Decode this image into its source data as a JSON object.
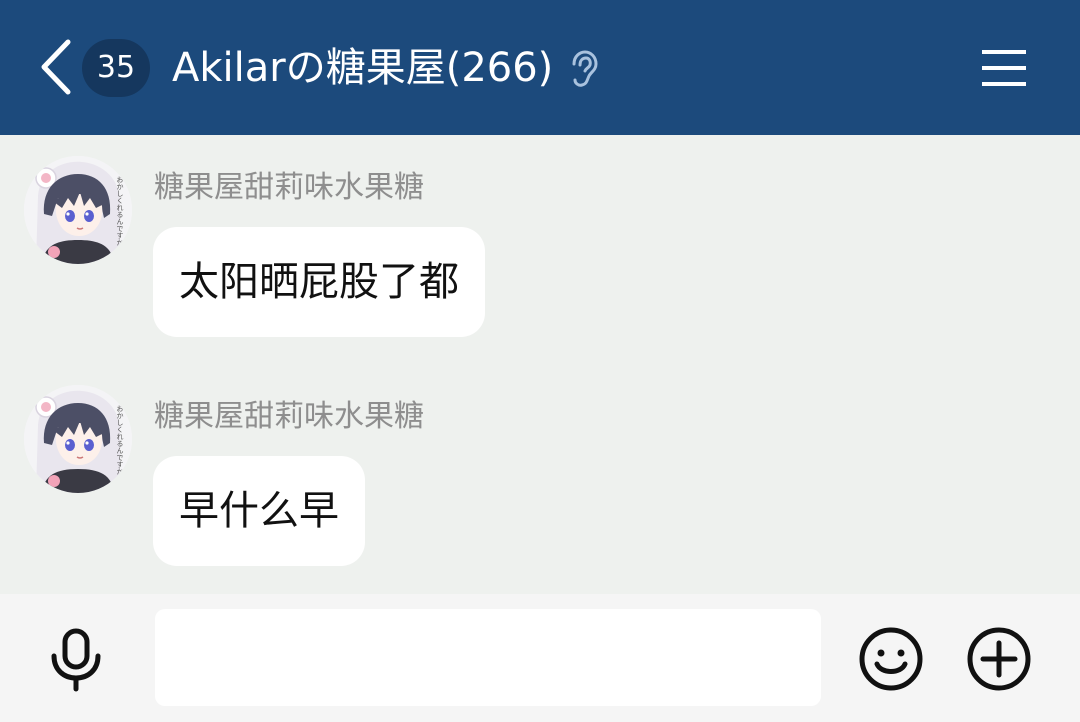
{
  "header": {
    "unread_count": "35",
    "title": "Akilarの糖果屋(266)",
    "background_color": "#1c4a7c",
    "icons": {
      "back": "chevron-left-icon",
      "listen_mode": "ear-icon",
      "menu": "hamburger-menu-icon"
    }
  },
  "messages": [
    {
      "sender": "糖果屋甜莉味水果糖",
      "text": "太阳晒屁股了都",
      "avatar": "anime-avatar"
    },
    {
      "sender": "糖果屋甜莉味水果糖",
      "text": "早什么早",
      "avatar": "anime-avatar"
    }
  ],
  "input_bar": {
    "text_value": "",
    "icons": {
      "voice": "microphone-icon",
      "emoji": "smiley-icon",
      "more": "plus-circle-icon"
    }
  }
}
